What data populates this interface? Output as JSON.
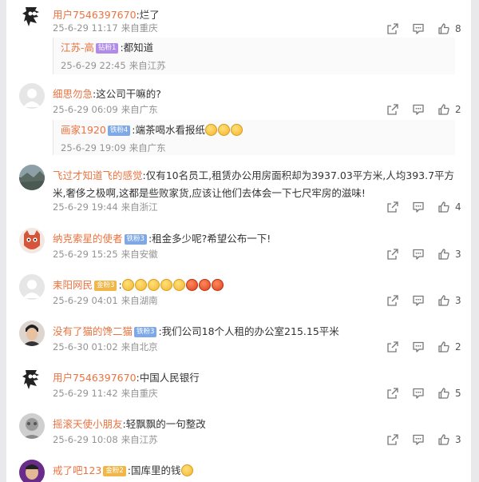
{
  "comments": [
    {
      "user": "用户7546397670",
      "text": ":烂了",
      "time": "25-6-29 11:17",
      "location": "来自重庆",
      "likes": "8",
      "reply": {
        "user": "江苏-高",
        "badge": "钻粉1",
        "text": ":都知道",
        "time": "25-6-29 22:45",
        "location": "来自江苏"
      }
    },
    {
      "user": "细思勿急",
      "text": ":这公司干嘛的?",
      "time": "25-6-29 06:09",
      "location": "来自广东",
      "likes": "2",
      "reply": {
        "user": "画家1920",
        "badge": "铁粉4",
        "text": ":端茶喝水看报纸",
        "time": "25-6-29 19:09",
        "location": "来自广东"
      }
    },
    {
      "user": "飞过才知道飞的感觉",
      "text": ":仅有10名员工,租赁办公用房面积却为3937.03平方米,人均393.7平方米,奢侈之极啊,这都是些败家货,应该让他们去体会一下七尺牢房的滋味!",
      "time": "25-6-29 19:44",
      "location": "来自浙江",
      "likes": "4"
    },
    {
      "user": "纳克索星的使者",
      "badge": "铁粉3",
      "text": ":租金多少呢?希望公布一下!",
      "time": "25-6-29 15:25",
      "location": "来自安徽",
      "likes": "3"
    },
    {
      "user": "耒阳网民",
      "badge": "金粉3",
      "text": ":",
      "time": "25-6-29 04:01",
      "location": "来自湖南",
      "likes": "3"
    },
    {
      "user": "没有了猫的馋二猫",
      "badge": "铁粉3",
      "text": ":我们公司18个人租的办公室215.15平米",
      "time": "25-6-30 01:02",
      "location": "来自北京",
      "likes": "2"
    },
    {
      "user": "用户7546397670",
      "text": ":中国人民银行",
      "time": "25-6-29 11:42",
      "location": "来自重庆",
      "likes": "5"
    },
    {
      "user": "摇滚天使小朋友",
      "text": ":轻飘飘的一句整改",
      "time": "25-6-29 10:08",
      "location": "来自江苏",
      "likes": "3"
    },
    {
      "user": "戒了吧123",
      "badge": "金粉2",
      "text": ":国库里的钱"
    }
  ],
  "icons": {
    "share": "share-icon",
    "comment": "comment-icon",
    "like": "thumbs-up-icon"
  },
  "colors": {
    "username": "#eb7340",
    "meta": "#939393"
  }
}
